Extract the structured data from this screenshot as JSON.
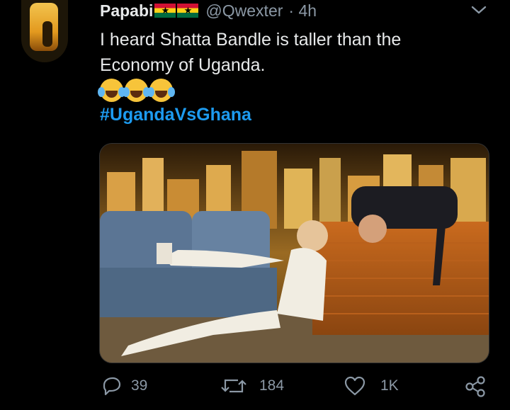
{
  "tweet": {
    "display_name": "Papabi",
    "handle": "@Qwexter",
    "time": "· 4h",
    "text": "I heard Shatta Bandle is taller than the Economy of Uganda.",
    "hashtag": "#UgandaVsGhana",
    "flag_star": "★"
  },
  "actions": {
    "replies": "39",
    "retweets": "184",
    "likes": "1K"
  },
  "colors": {
    "background": "#000000",
    "link": "#1d9bf0",
    "secondary_text": "#8b98a5"
  }
}
